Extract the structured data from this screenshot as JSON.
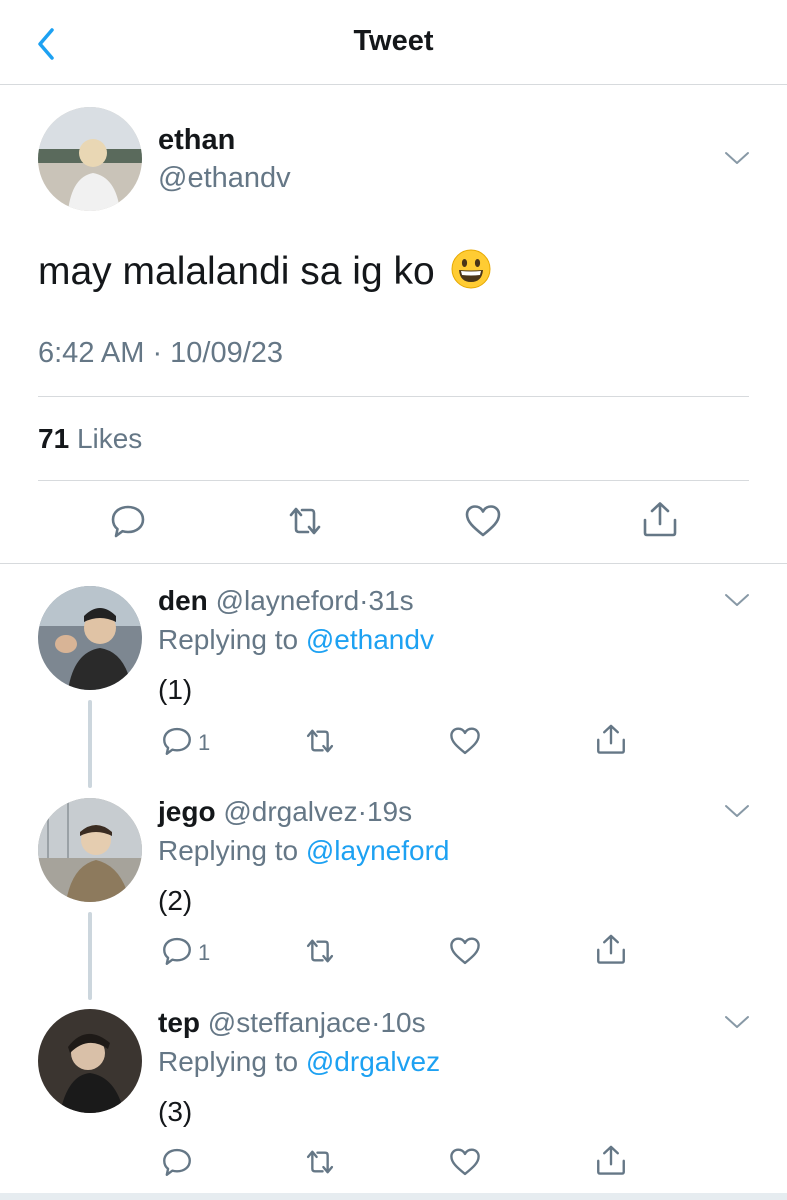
{
  "header": {
    "title": "Tweet"
  },
  "main_tweet": {
    "name": "ethan",
    "handle": "@ethandv",
    "text": "may malalandi sa ig ko",
    "emoji": "grinning-face",
    "timestamp": "6:42 AM · 10/09/23",
    "likes_count": "71",
    "likes_label": "Likes"
  },
  "replies": [
    {
      "name": "den",
      "handle": "@layneford",
      "time": "31s",
      "replying_prefix": "Replying to",
      "replying_to": "@ethandv",
      "text": "(1)",
      "reply_count": "1"
    },
    {
      "name": "jego",
      "handle": "@drgalvez",
      "time": "19s",
      "replying_prefix": "Replying to",
      "replying_to": "@layneford",
      "text": "(2)",
      "reply_count": "1"
    },
    {
      "name": "tep",
      "handle": "@steffanjace",
      "time": "10s",
      "replying_prefix": "Replying to",
      "replying_to": "@drgalvez",
      "text": "(3)",
      "reply_count": ""
    }
  ],
  "colors": {
    "accent": "#1da1f2",
    "text_primary": "#14171a",
    "text_secondary": "#657786",
    "divider": "#d7dadd"
  },
  "icons": [
    "back-chevron-icon",
    "chevron-down-icon",
    "reply-icon",
    "retweet-icon",
    "like-icon",
    "share-icon"
  ]
}
